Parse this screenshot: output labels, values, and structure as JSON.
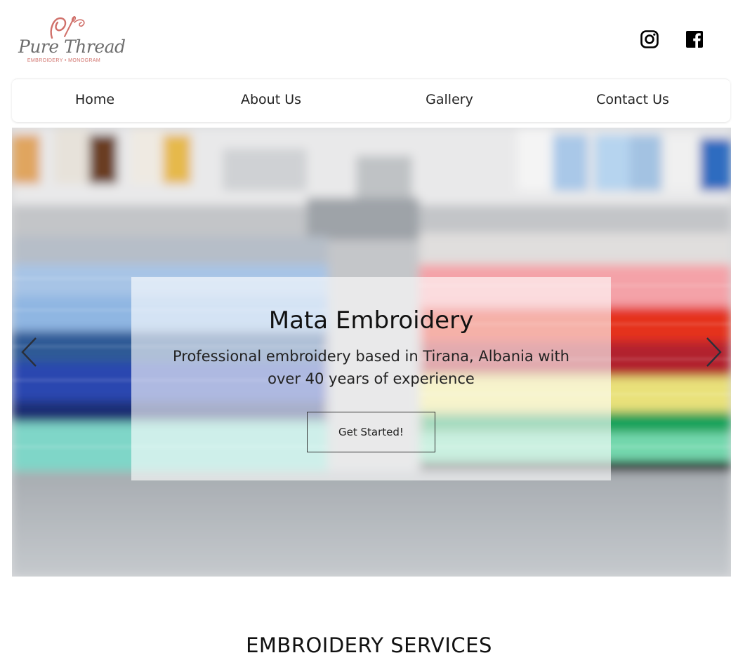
{
  "brand": {
    "name": "Pure Thread",
    "tagline": "EMBROIDERY • MONOGRAM",
    "accent_color": "#d0706a"
  },
  "social": [
    {
      "name": "instagram-icon"
    },
    {
      "name": "facebook-icon"
    }
  ],
  "nav": {
    "items": [
      {
        "label": "Home"
      },
      {
        "label": "About Us"
      },
      {
        "label": "Gallery"
      },
      {
        "label": "Contact Us"
      }
    ]
  },
  "hero": {
    "title": "Mata Embroidery",
    "text": "Professional embroidery based in Tirana, Albania with over 40 years of experience",
    "cta_label": "Get Started!",
    "prev_icon": "chevron-left-icon",
    "next_icon": "chevron-right-icon"
  },
  "section": {
    "title": "EMBROIDERY SERVICES"
  }
}
